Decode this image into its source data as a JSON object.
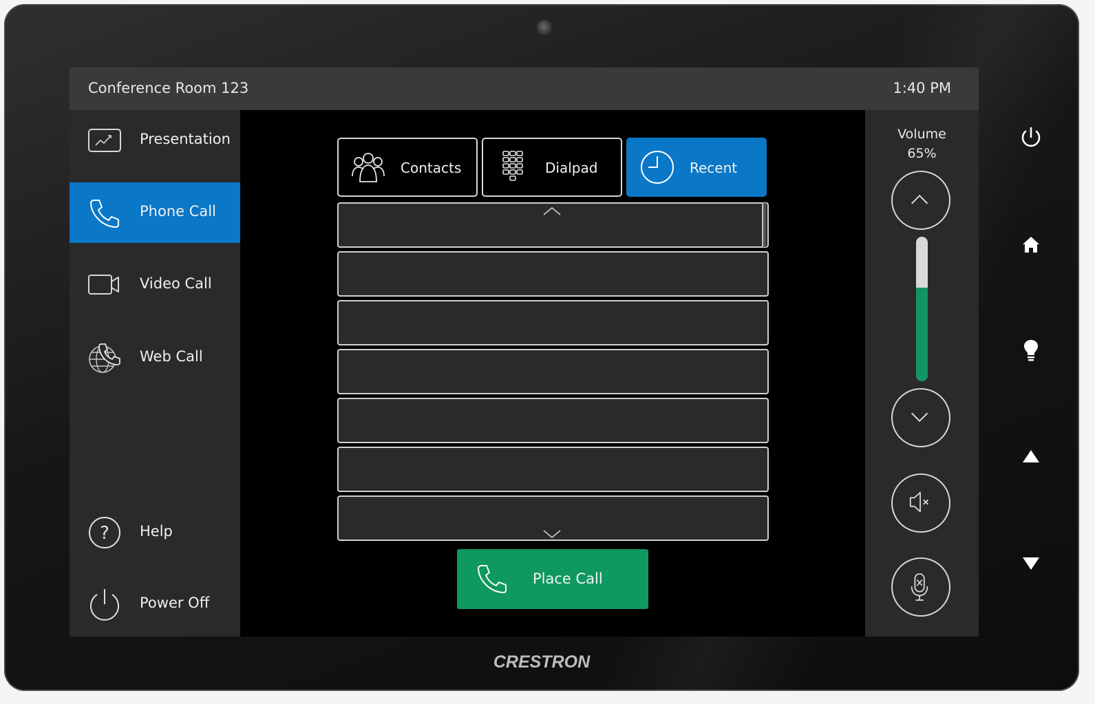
{
  "header": {
    "room_name": "Conference Room 123",
    "time": "1:40 PM"
  },
  "sidebar": {
    "items": [
      {
        "label": "Presentation",
        "icon": "presentation-icon"
      },
      {
        "label": "Phone Call",
        "icon": "phone-icon",
        "active": true
      },
      {
        "label": "Video Call",
        "icon": "video-camera-icon"
      },
      {
        "label": "Web Call",
        "icon": "globe-phone-icon"
      }
    ],
    "bottom_items": [
      {
        "label": "Help",
        "icon": "help-icon"
      },
      {
        "label": "Power Off",
        "icon": "power-icon"
      }
    ]
  },
  "tabs": [
    {
      "label": "Contacts",
      "icon": "contacts-icon"
    },
    {
      "label": "Dialpad",
      "icon": "dialpad-icon"
    },
    {
      "label": "Recent",
      "icon": "clock-icon",
      "active": true
    }
  ],
  "recent_list": {
    "rows": [
      "",
      "",
      "",
      "",
      "",
      "",
      ""
    ]
  },
  "place_call": {
    "label": "Place Call",
    "icon": "phone-icon"
  },
  "volume": {
    "label": "Volume",
    "percent_text": "65%",
    "level": 0.65
  },
  "controls": [
    "volume-up-icon",
    "volume-down-icon",
    "speaker-mute-icon",
    "microphone-mute-icon"
  ],
  "hardware_buttons": [
    "power-icon",
    "home-icon",
    "lightbulb-icon",
    "arrow-up-icon",
    "arrow-down-icon"
  ],
  "device": {
    "brand": "CRESTRON"
  },
  "colors": {
    "accent_blue": "#0a77c7",
    "call_green": "#0f9860",
    "volume_green": "#129463",
    "panel_gray": "#2a2a2a",
    "header_gray": "#3a3a3a"
  }
}
